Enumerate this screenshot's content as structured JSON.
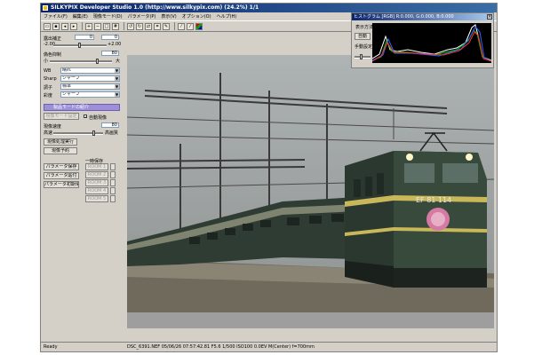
{
  "window": {
    "title": "SILKYPIX Developer Studio 1.0 (http://www.silkypix.com) (24.2%) 1/1"
  },
  "menu": [
    "ファイル(F)",
    "編集(E)",
    "現像モード(D)",
    "パラメータ(P)",
    "表示(V)",
    "オプション(O)",
    "ヘルプ(H)"
  ],
  "panel": {
    "exposure_label": "露出補正",
    "exposure_value": "0",
    "exposure_value2": "0",
    "scale_min": "-2.00",
    "scale_max": "+2.00",
    "false_color_label": "偽色抑制",
    "false_color_value": "80",
    "scale_small": "小",
    "scale_large": "大",
    "wb_label": "WB",
    "wb_value": "晴れ",
    "sharp_label": "Sharp",
    "sharp_value": "シャープ",
    "tone_label": "調子",
    "tone_value": "標準",
    "color_label": "彩度",
    "color_value": "シャープ",
    "banner_label": "製品モードの紹介",
    "develop_btn": "現像モード設定",
    "auto_check_label": "自動現像",
    "develop_speed_label": "現像速度",
    "develop_speed_value": "80",
    "speed_low": "高速",
    "speed_high": "高画質",
    "btn_batch": "現像処理実行",
    "btn_reserve": "現像予約",
    "temp_save_label": "一時保存",
    "param_copy": "パラメータ保存",
    "param_paste": "パラメータ貼付",
    "param_init": "パラメータ初期化",
    "rooms": [
      "ROOM 1",
      "ROOM 2",
      "ROOM 3",
      "ROOM 4",
      "ROOM 5"
    ]
  },
  "histogram": {
    "title": "ヒストグラム [RGB] R:0.000, G:0.000, B:0.000",
    "display_label": "表示方法",
    "mode_auto": "自動",
    "mode_manual": "手動設定"
  },
  "status": {
    "ready": "Ready",
    "info": "DSC_6391.NEF 05/06/26 07:57:42.81 F5.6 1/500 ISO100 0.0EV M(Center) f=700mm"
  },
  "photo": {
    "loco_number": "EF 81 114"
  }
}
